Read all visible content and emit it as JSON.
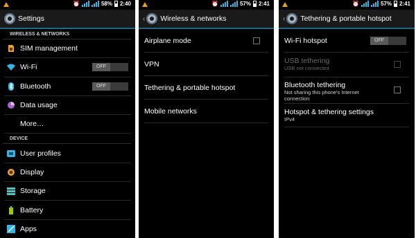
{
  "status": {
    "s1": {
      "battery": "58%",
      "time": "2:40"
    },
    "s2": {
      "battery": "57%",
      "time": "2:41"
    },
    "s3": {
      "battery": "57%",
      "time": "2:41"
    }
  },
  "settings": {
    "title": "Settings",
    "section_wireless": "WIRELESS & NETWORKS",
    "section_device": "DEVICE",
    "items": [
      {
        "label": "SIM management",
        "icon": "sim-card-icon",
        "color": "#f0a030"
      },
      {
        "label": "Wi-Fi",
        "icon": "wifi-icon",
        "color": "#33b5e5",
        "toggle": "OFF"
      },
      {
        "label": "Bluetooth",
        "icon": "bluetooth-icon",
        "color": "#33b5e5",
        "toggle": "OFF"
      },
      {
        "label": "Data usage",
        "icon": "data-usage-icon",
        "color": "#aa66cc"
      },
      {
        "label": "More…"
      },
      {
        "label": "User profiles",
        "icon": "user-profiles-icon",
        "color": "#33b5e5"
      },
      {
        "label": "Display",
        "icon": "display-icon",
        "color": "#f0a030"
      },
      {
        "label": "Storage",
        "icon": "storage-icon",
        "color": "#4ec4c4"
      },
      {
        "label": "Battery",
        "icon": "battery-icon",
        "color": "#99cc00"
      },
      {
        "label": "Apps",
        "icon": "apps-icon",
        "color": "#33b5e5"
      }
    ]
  },
  "wireless": {
    "title": "Wireless & networks",
    "items": [
      "Airplane mode",
      "VPN",
      "Tethering & portable hotspot",
      "Mobile networks"
    ]
  },
  "tethering": {
    "title": "Tethering & portable hotspot",
    "wifi_hotspot": "Wi-Fi hotspot",
    "wifi_toggle": "OFF",
    "usb_title": "USB tethering",
    "usb_sub": "USB not connected",
    "bt_title": "Bluetooth tethering",
    "bt_sub": "Not sharing this phone's Internet connection",
    "hs_title": "Hotspot & tethering settings",
    "hs_sub": "IPv4"
  }
}
